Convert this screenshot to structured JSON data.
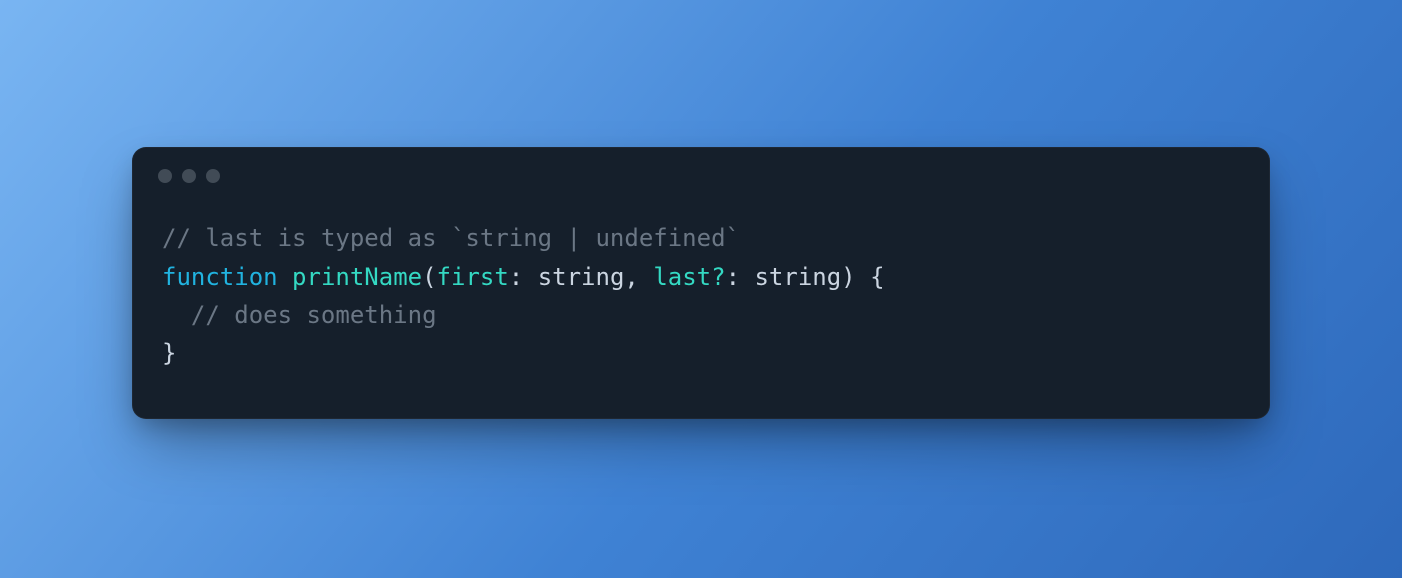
{
  "code": {
    "line1": {
      "comment": "// last is typed as `string | undefined`"
    },
    "line2": {
      "keyword": "function",
      "space1": " ",
      "funcName": "printName",
      "open": "(",
      "param1": "first",
      "colon1": ": ",
      "type1": "string",
      "comma": ", ",
      "param2": "last?",
      "colon2": ": ",
      "type2": "string",
      "close": ")",
      "space2": " ",
      "brace": "{"
    },
    "line3": {
      "comment": "// does something"
    },
    "line4": {
      "brace": "}"
    }
  }
}
